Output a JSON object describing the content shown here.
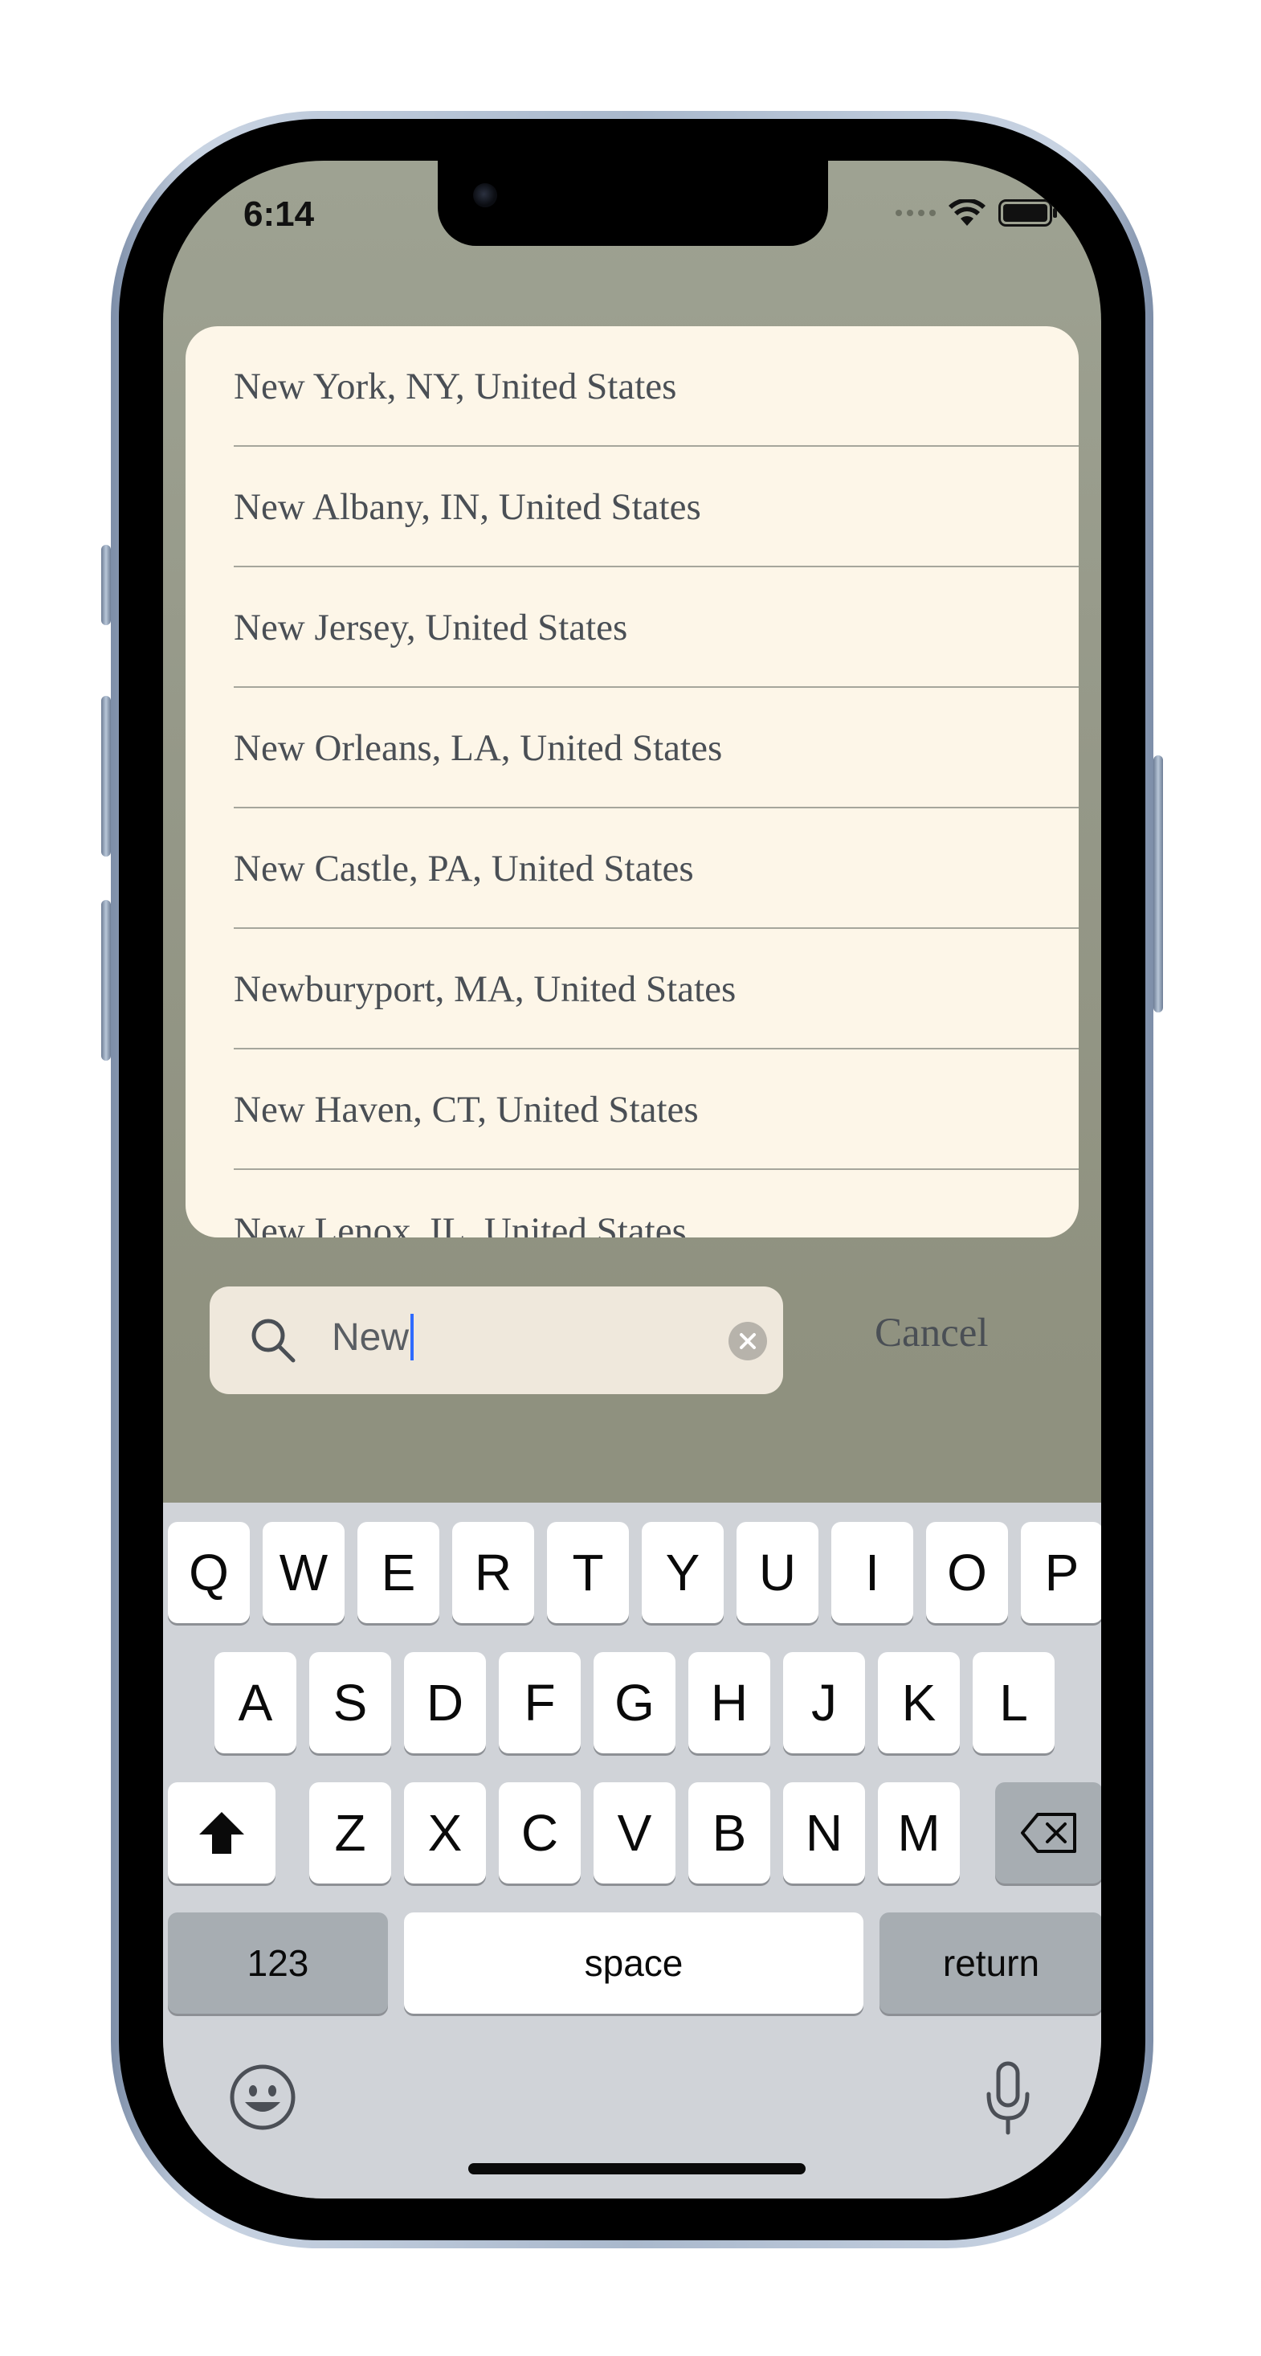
{
  "status_bar": {
    "time": "6:14"
  },
  "results": [
    "New York, NY, United States",
    "New Albany, IN, United States",
    "New Jersey, United States",
    "New Orleans, LA, United States",
    "New Castle, PA, United States",
    "Newburyport, MA, United States",
    "New Haven, CT, United States",
    "New Lenox, IL, United States"
  ],
  "search": {
    "value": "New"
  },
  "cancel_label": "Cancel",
  "keyboard": {
    "row1": [
      "Q",
      "W",
      "E",
      "R",
      "T",
      "Y",
      "U",
      "I",
      "O",
      "P"
    ],
    "row2": [
      "A",
      "S",
      "D",
      "F",
      "G",
      "H",
      "J",
      "K",
      "L"
    ],
    "row3": [
      "Z",
      "X",
      "C",
      "V",
      "B",
      "N",
      "M"
    ],
    "numbers_label": "123",
    "space_label": "space",
    "return_label": "return"
  },
  "colors": {
    "background": "#8f917f",
    "card": "#fdf6e8",
    "search_field": "#efe8dc",
    "caret": "#2f6bff"
  }
}
